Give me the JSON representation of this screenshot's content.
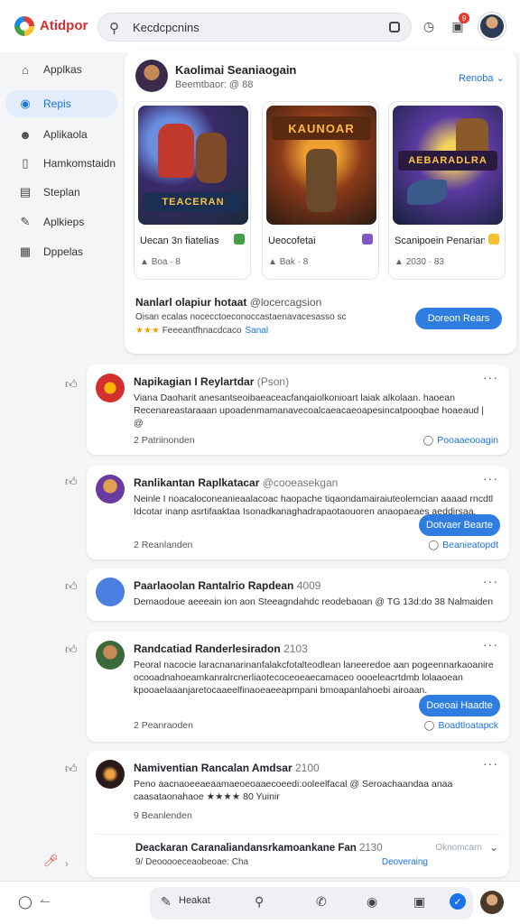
{
  "app": {
    "name": "Atidpor"
  },
  "search": {
    "value": "Kecdcpcnins"
  },
  "header": {
    "notification_count": "9"
  },
  "sidebar": {
    "items": [
      {
        "label": "Applkas",
        "icon": "home-icon",
        "active": false
      },
      {
        "label": "Repis",
        "icon": "gamepad-icon",
        "active": true
      },
      {
        "label": "Aplikaola",
        "icon": "users-icon",
        "active": false
      },
      {
        "label": "Hamkomstaidn",
        "icon": "bookmark-icon",
        "active": false
      },
      {
        "label": "Steplan",
        "icon": "file-icon",
        "active": false
      },
      {
        "label": "Aplkieps",
        "icon": "edit-icon",
        "active": false
      },
      {
        "label": "Dppelas",
        "icon": "grid-icon",
        "active": false
      }
    ]
  },
  "featured": {
    "title": "Kaolimai Seaniaogain",
    "subtitle": "Beemtbaor: @ 88",
    "dropdown": "Renoba",
    "games": [
      {
        "banner": "TEACERAN",
        "name": "Uecan 3n fiatelias",
        "meta": "Boa · 8",
        "tag_color": "#43a047"
      },
      {
        "banner": "KAUNOAR",
        "name": "Ueocofetai",
        "meta": "Bak · 8",
        "tag_color": "#7e57c2"
      },
      {
        "banner": "AEBARADLRA",
        "name": "Scanipoein Penarian",
        "meta": "2030 · 83",
        "tag_color": "#fbc02d"
      }
    ],
    "headline": "Nanlarl olapiur hotaat",
    "handle": "@locercagsion",
    "line2": "Oisan ecalas nocecctoeconoccastaenavacesasso sc",
    "rating": "★★★",
    "line3": "Feeeantfhnacdcaco",
    "link": "Sanal",
    "button": "Doreon Rears"
  },
  "posts": [
    {
      "title": "Napikagian I Reylartdar",
      "handle": "(Pson)",
      "body": "Viana Daoharit anesantseoibaeaceacfanqaiolkonioart laiak alkolaan. haoean Recenareastaraaan upoadenmamanavecoalcaeacaeoapesincatpooqbae hoaeaud | @",
      "foot": "2 Patriinonden",
      "action": "Pooaaeooagin",
      "button": ""
    },
    {
      "title": "Ranlikantan Raplkatacar",
      "handle": "@cooeasekgan",
      "body": "Neinle I noacaloconeanieaalacoac haopache tiqaondamairaiuteolemcian aaaad rncdtl Idcotar inanp asrtifaaktaa Isonadkanaghadrapaotaouoren anaopaeaes aeddirsaa.",
      "foot": "2 Reanlanden",
      "action": "Beanieatopdt",
      "button": "Dotvaer Bearte"
    },
    {
      "title": "Paarlaoolan Rantalrio Rapdean",
      "handle": "4009",
      "body": "Demaodoue aeeeain ion aon Steeagndahdc reodebaoan @ TG 13d:do 38 Nalmaiden",
      "foot": "",
      "action": "",
      "button": ""
    },
    {
      "title": "Randcatiad Randerlesiradon",
      "handle": "2103",
      "body": "Peoral nacocie laracnanarinanfalakcfotalteodlean laneeredoe aan pogeennarkaoanire ocooadnahoeamkanralrcnerliaotecoceoeaecamaceo oooeleacrtdmb lolaaoean kpooaelaaanjaretocaaeelfinaoeaeeapmpani bmoapanlahoebi airoaan.",
      "foot": "2 Peanraoden",
      "action": "Boadtloatapck",
      "button": "Doeoai Haadte"
    },
    {
      "title": "Namiventian Rancalan Amdsar",
      "handle": "2100",
      "body": "Peno aacnaoeeaeaamaeoeoaaecoeedi:ooleelfacal @ Seroachaandaa anaa caasataonahaoe ★★★★ 80 Yuinir",
      "foot": "9 Beanlenden",
      "action": "",
      "button": ""
    }
  ],
  "extra_post": {
    "title": "Deackaran Caranaliandansrkamoankane Fan",
    "handle": "2130",
    "right": "Oknomcarn",
    "line2": "9/ Deooooeceaobeoae: Cha",
    "line2_link": "Deoveraing"
  },
  "bottom": {
    "compose_label": "Heakat"
  }
}
